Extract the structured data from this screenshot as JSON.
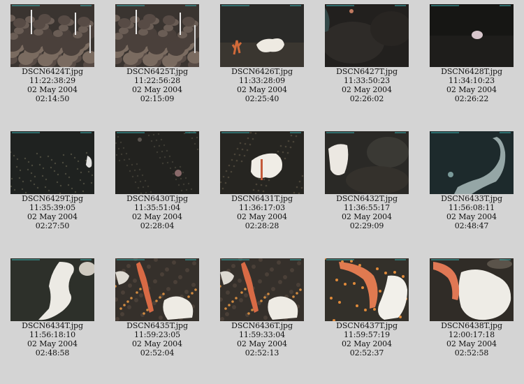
{
  "gallery": {
    "items": [
      {
        "file": "DSCN6424T.jpg",
        "time": "11:22:38:29",
        "date": "02 May 2004",
        "elapsed": "02:14:50",
        "scene": "rocks-poles"
      },
      {
        "file": "DSCN6425T.jpg",
        "time": "11:22:56:28",
        "date": "02 May 2004",
        "elapsed": "02:15:09",
        "scene": "rocks-poles"
      },
      {
        "file": "DSCN6426T.jpg",
        "time": "11:33:28:09",
        "date": "02 May 2004",
        "elapsed": "02:25:40",
        "scene": "sponge-small"
      },
      {
        "file": "DSCN6427T.jpg",
        "time": "11:33:50:23",
        "date": "02 May 2004",
        "elapsed": "02:26:02",
        "scene": "dark-rock"
      },
      {
        "file": "DSCN6428T.jpg",
        "time": "11:34:10:23",
        "date": "02 May 2004",
        "elapsed": "02:26:22",
        "scene": "dark-dot"
      },
      {
        "file": "DSCN6429T.jpg",
        "time": "11:35:39:05",
        "date": "02 May 2004",
        "elapsed": "02:27:50",
        "scene": "seafloor-edge"
      },
      {
        "file": "DSCN6430T.jpg",
        "time": "11:35:51:04",
        "date": "02 May 2004",
        "elapsed": "02:28:04",
        "scene": "seafloor-dot"
      },
      {
        "file": "DSCN6431T.jpg",
        "time": "11:36:17:03",
        "date": "02 May 2004",
        "elapsed": "02:28:28",
        "scene": "sponge-center"
      },
      {
        "file": "DSCN6432T.jpg",
        "time": "11:36:55:17",
        "date": "02 May 2004",
        "elapsed": "02:29:09",
        "scene": "sponge-left"
      },
      {
        "file": "DSCN6433T.jpg",
        "time": "11:56:08:11",
        "date": "02 May 2004",
        "elapsed": "02:48:47",
        "scene": "sponge-curve"
      },
      {
        "file": "DSCN6434T.jpg",
        "time": "11:56:18:10",
        "date": "02 May 2004",
        "elapsed": "02:48:58",
        "scene": "sponge-big"
      },
      {
        "file": "DSCN6435T.jpg",
        "time": "11:59:23:05",
        "date": "02 May 2004",
        "elapsed": "02:52:04",
        "scene": "coral-sponge"
      },
      {
        "file": "DSCN6436T.jpg",
        "time": "11:59:33:04",
        "date": "02 May 2004",
        "elapsed": "02:52:13",
        "scene": "coral-sponge"
      },
      {
        "file": "DSCN6437T.jpg",
        "time": "11:59:57:19",
        "date": "02 May 2004",
        "elapsed": "02:52:37",
        "scene": "coral-big"
      },
      {
        "file": "DSCN6438T.jpg",
        "time": "12:00:17:18",
        "date": "02 May 2004",
        "elapsed": "02:52:58",
        "scene": "coral-sponge-big"
      }
    ]
  }
}
